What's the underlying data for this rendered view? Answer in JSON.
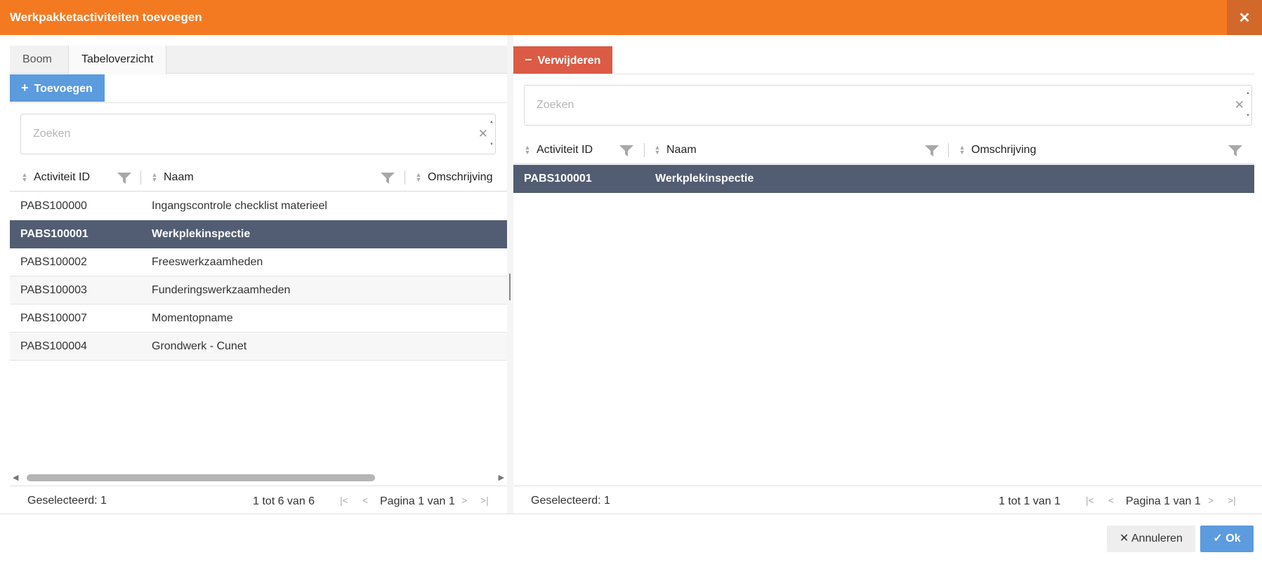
{
  "dialog": {
    "title": "Werkpakketactiviteiten toevoegen",
    "close_glyph": "✕"
  },
  "left": {
    "tabs": [
      {
        "label": "Boom"
      },
      {
        "label": "Tabeloverzicht"
      }
    ],
    "add_button": {
      "icon": "plus-icon",
      "label": "Toevoegen"
    },
    "search": {
      "placeholder": "Zoeken",
      "clear_glyph": "✕"
    },
    "columns": [
      {
        "label": "Activiteit ID"
      },
      {
        "label": "Naam"
      },
      {
        "label": "Omschrijving"
      }
    ],
    "rows": [
      {
        "id": "PABS100000",
        "name": "Ingangscontrole checklist materieel",
        "selected": false
      },
      {
        "id": "PABS100001",
        "name": "Werkplekinspectie",
        "selected": true
      },
      {
        "id": "PABS100002",
        "name": "Freeswerkzaamheden",
        "selected": false
      },
      {
        "id": "PABS100003",
        "name": "Funderingswerkzaamheden",
        "selected": false
      },
      {
        "id": "PABS100007",
        "name": "Momentopname",
        "selected": false
      },
      {
        "id": "PABS100004",
        "name": "Grondwerk - Cunet",
        "selected": false
      }
    ],
    "footer": {
      "selected": "Geselecteerd: 1",
      "range": "1 tot 6 van 6",
      "page": "Pagina 1 van 1"
    }
  },
  "right": {
    "remove_button": {
      "icon": "minus-icon",
      "label": "Verwijderen"
    },
    "search": {
      "placeholder": "Zoeken",
      "clear_glyph": "✕"
    },
    "columns": [
      {
        "label": "Activiteit ID"
      },
      {
        "label": "Naam"
      },
      {
        "label": "Omschrijving"
      }
    ],
    "rows": [
      {
        "id": "PABS100001",
        "name": "Werkplekinspectie",
        "selected": true
      }
    ],
    "footer": {
      "selected": "Geselecteerd: 1",
      "range": "1 tot 1 van 1",
      "page": "Pagina 1 van 1"
    }
  },
  "actions": {
    "cancel_glyph": "✕",
    "cancel_label": "Annuleren",
    "ok_glyph": "✓",
    "ok_label": "Ok"
  },
  "colors": {
    "title_bar": "#f47a22",
    "add": "#5b9bde",
    "remove": "#db5b45",
    "selected_row": "#525d73"
  }
}
